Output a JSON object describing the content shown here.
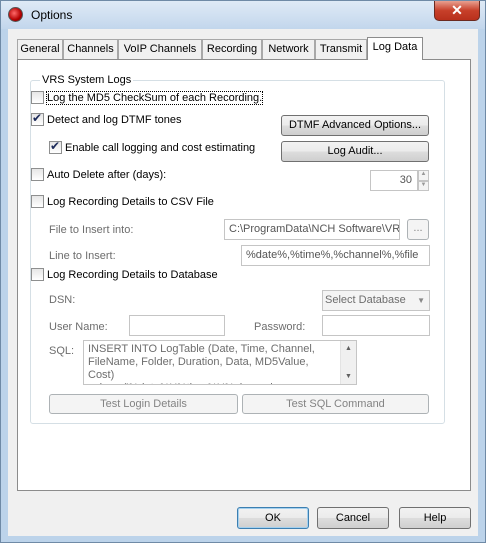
{
  "window": {
    "title": "Options",
    "close_glyph": "✕"
  },
  "tabs": [
    {
      "label": "General"
    },
    {
      "label": "Channels"
    },
    {
      "label": "VoIP Channels"
    },
    {
      "label": "Recording"
    },
    {
      "label": "Network"
    },
    {
      "label": "Transmit"
    },
    {
      "label": "Log Data",
      "active": true
    }
  ],
  "group": {
    "legend": "VRS System Logs",
    "md5_checksum": {
      "label": "Log the MD5 CheckSum of each Recording.",
      "checked": false
    },
    "dtmf": {
      "label": "Detect and log DTMF tones",
      "checked": true
    },
    "dtmf_advanced_button": "DTMF Advanced Options...",
    "call_logging": {
      "label": "Enable call logging and cost estimating",
      "checked": true
    },
    "log_audit_button": "Log Audit...",
    "auto_delete": {
      "label": "Auto Delete after (days):",
      "checked": false,
      "value": "30"
    },
    "csv": {
      "label": "Log Recording Details to CSV File",
      "checked": false,
      "file_label": "File to Insert into:",
      "file_value": "C:\\ProgramData\\NCH Software\\VRS",
      "browse_button": "...",
      "line_label": "Line to Insert:",
      "line_value": "%date%,%time%,%channel%,%file"
    },
    "database": {
      "label": "Log Recording Details to Database",
      "checked": false,
      "dsn_label": "DSN:",
      "dsn_value": "Select Database",
      "username_label": "User Name:",
      "username_value": "",
      "password_label": "Password:",
      "password_value": "",
      "sql_label": "SQL:",
      "sql_value": "INSERT INTO LogTable (Date, Time, Channel,\nFileName, Folder, Duration, Data, MD5Value, Cost)\nvalues ('%date%','%time%','%channel",
      "test_login_button": "Test Login Details",
      "test_sql_button": "Test SQL Command"
    }
  },
  "footer": {
    "ok": "OK",
    "cancel": "Cancel",
    "help": "Help"
  }
}
